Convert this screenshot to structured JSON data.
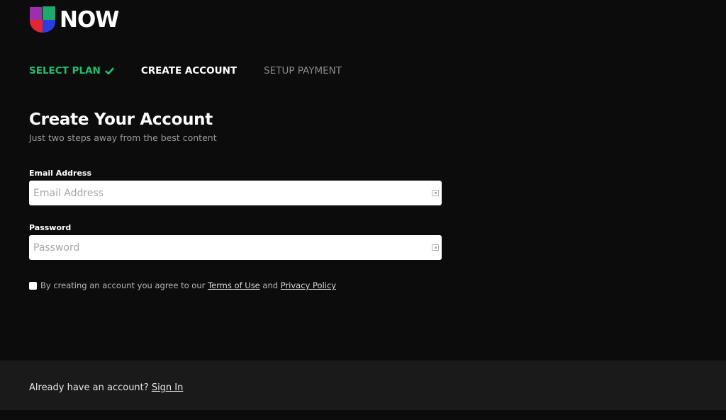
{
  "brand": {
    "name": "NOW",
    "logo_colors": {
      "top_left": "#9b2fae",
      "top_right": "#1fa86b",
      "bottom_left": "#e3262f",
      "bottom_right": "#2a3ee0"
    }
  },
  "steps": [
    {
      "label": "SELECT PLAN",
      "state": "done",
      "icon": "check-icon"
    },
    {
      "label": "CREATE ACCOUNT",
      "state": "active"
    },
    {
      "label": "SETUP PAYMENT",
      "state": "pending"
    }
  ],
  "form": {
    "title": "Create Your Account",
    "subtitle": "Just two steps away from the best content",
    "email": {
      "label": "Email Address",
      "placeholder": "Email Address",
      "value": ""
    },
    "password": {
      "label": "Password",
      "placeholder": "Password",
      "value": ""
    },
    "terms": {
      "checked": false,
      "prefix": "By creating an account you agree to our",
      "terms_link": "Terms of Use",
      "conjunction": "and",
      "privacy_link": "Privacy Policy"
    }
  },
  "footer": {
    "prompt": "Already have an account?",
    "sign_in_link": "Sign In"
  },
  "colors": {
    "background": "#0c0c0c",
    "footer_bg": "#1a1a1a",
    "step_done": "#1fbf6e",
    "step_pending": "#8a8a8a"
  }
}
